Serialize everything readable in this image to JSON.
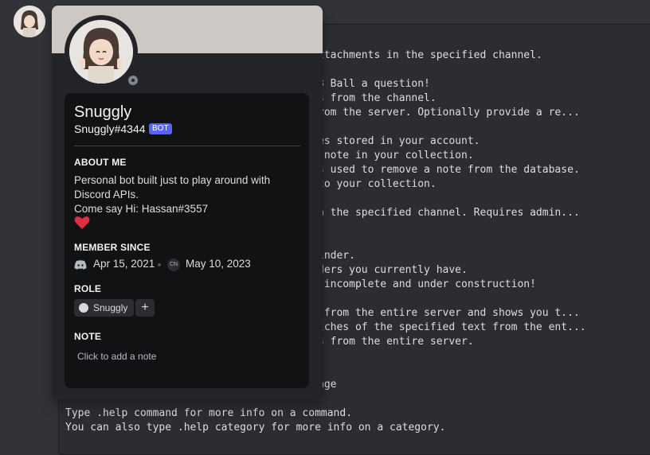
{
  "code_lines": [
    "ttachments in the specified channel.",
    "3 Ball a question!",
    "s from the channel.",
    "rom the server. Optionally provide a re...",
    "es stored in your account.",
    " note in your collection.",
    "s used to remove a note from the database.",
    "to your collection.",
    "n the specified channel. Requires admin...",
    "inder.",
    "ders you currently have.",
    " incomplete and under construction!",
    " from the entire server and shows you t...",
    "tches of the specified text from the ent...",
    "s from the entire server.",
    "age",
    "Type .help command for more info on a command.",
    "You can also type .help category for more info on a category."
  ],
  "profile": {
    "username": "Snuggly",
    "tag": "Snuggly#4344",
    "bot_badge": "BOT",
    "about_heading": "ABOUT ME",
    "about_lines": [
      "Personal bot built just to play around with",
      "Discord APIs.",
      "Come say Hi: Hassan#3557"
    ],
    "member_since_heading": "MEMBER SINCE",
    "discord_joined": "Apr 15, 2021",
    "server_icon_text": "CN",
    "server_joined": "May 10, 2023",
    "role_heading": "ROLE",
    "role_name": "Snuggly",
    "role_color": "#d9d9d9",
    "add_role_symbol": "+",
    "note_heading": "NOTE",
    "note_placeholder": "Click to add a note",
    "status": "offline",
    "icons": [
      "heart-icon",
      "discord-icon",
      "add-icon",
      "status-offline-icon"
    ]
  },
  "colors": {
    "bot_badge": "#5865f2",
    "heart": "#dd2e44",
    "banner": "#cdc8c4"
  }
}
